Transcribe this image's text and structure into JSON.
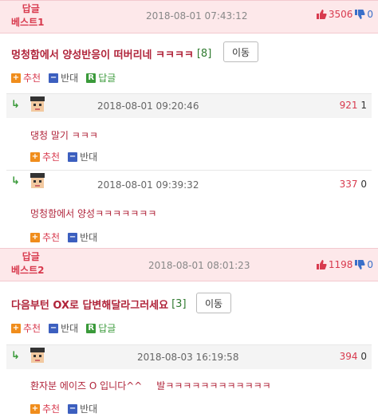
{
  "best1": {
    "label_line1": "답글",
    "label_line2": "베스트1",
    "date": "2018-08-01 07:43:12",
    "up_count": "3506",
    "down_count": "0",
    "title": "멍청함에서 양성반응이 떠버리네 ㅋㅋㅋㅋ",
    "reply_count": "[8]",
    "move_label": "이동",
    "actions": {
      "recommend": "추천",
      "oppose": "반대",
      "reply": "답글"
    },
    "replies": [
      {
        "date": "2018-08-01 09:20:46",
        "up": "921",
        "down": "1",
        "text": "댕청 말기 ㅋㅋㅋ",
        "recommend": "추천",
        "oppose": "반대"
      },
      {
        "date": "2018-08-01 09:39:32",
        "up": "337",
        "down": "0",
        "text": "멍청함에서 양성ㅋㅋㅋㅋㅋㅋㅋ",
        "recommend": "추천",
        "oppose": "반대"
      }
    ]
  },
  "best2": {
    "label_line1": "답글",
    "label_line2": "베스트2",
    "date": "2018-08-01 08:01:23",
    "up_count": "1198",
    "down_count": "0",
    "title": "다음부턴 OX로 답변해달라그러세요",
    "reply_count": "[3]",
    "move_label": "이동",
    "actions": {
      "recommend": "추천",
      "oppose": "반대",
      "reply": "답글"
    },
    "replies": [
      {
        "date": "2018-08-03 16:19:58",
        "up": "394",
        "down": "0",
        "text": "환자분 에이즈 O 입니다^^",
        "tail": "발ㅋㅋㅋㅋㅋㅋㅋㅋㅋㅋㅋㅋ",
        "recommend": "추천",
        "oppose": "반대"
      }
    ]
  },
  "colors": {
    "accent_red": "#d83a4e",
    "header_bg": "#fde8ea",
    "recommend_orange": "#f08d1c",
    "oppose_blue": "#3c5fbf",
    "reply_green": "#3a9a3a"
  }
}
